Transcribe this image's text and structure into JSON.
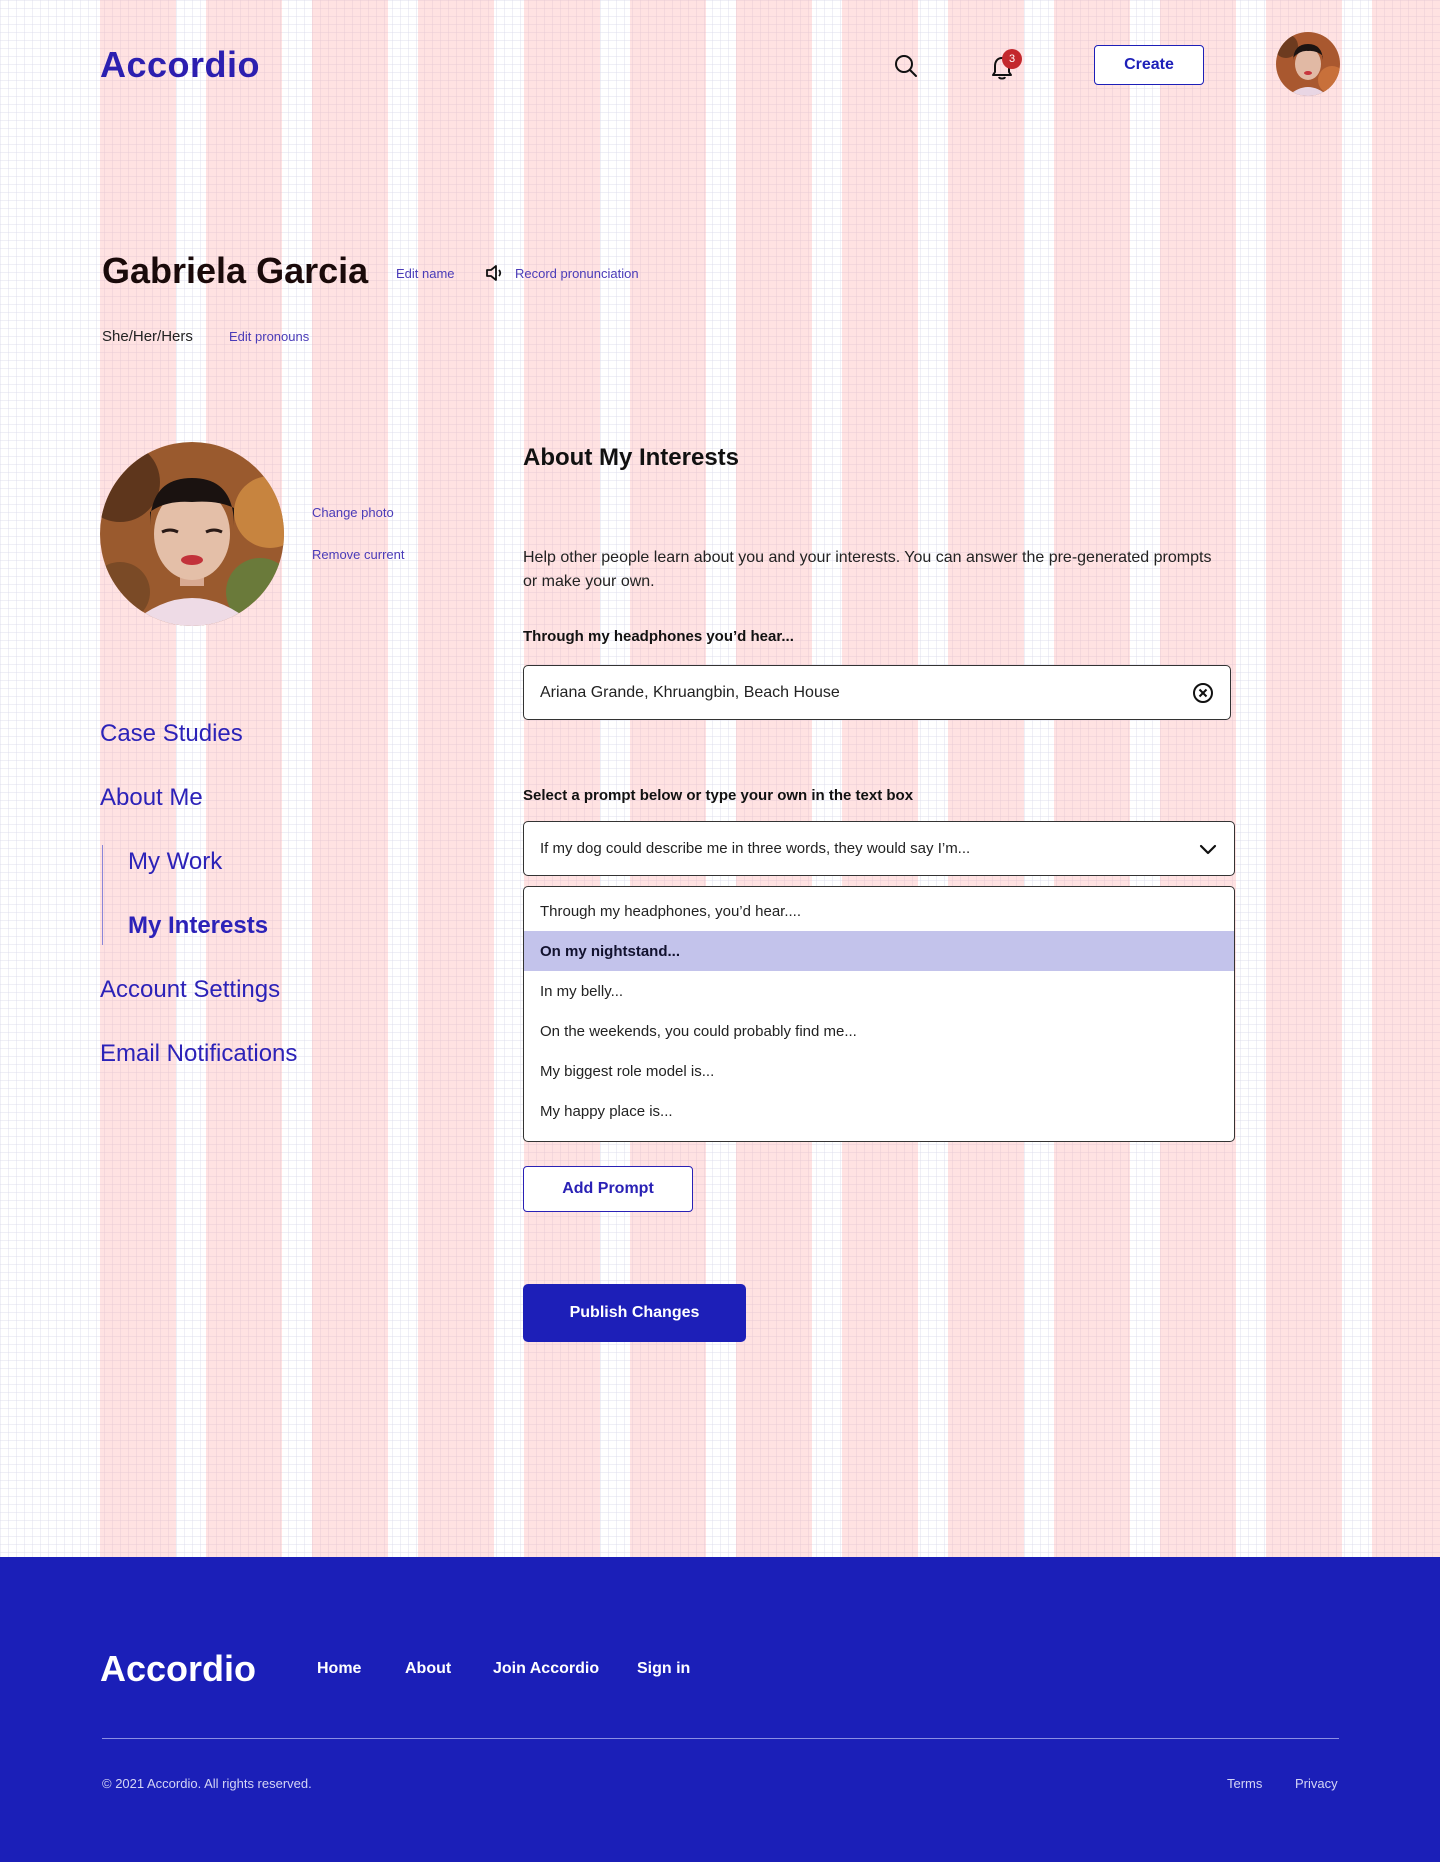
{
  "header": {
    "logo": "Accordio",
    "notification_count": "3",
    "create_label": "Create"
  },
  "profile": {
    "name": "Gabriela Garcia",
    "edit_name": "Edit name",
    "record_pronunciation": "Record pronunciation",
    "pronouns": "She/Her/Hers",
    "edit_pronouns": "Edit pronouns",
    "change_photo": "Change photo",
    "remove_current": "Remove current"
  },
  "sidebar": {
    "items": [
      {
        "label": "Case Studies"
      },
      {
        "label": "About Me"
      },
      {
        "label": "My Work"
      },
      {
        "label": "My Interests"
      },
      {
        "label": "Account Settings"
      },
      {
        "label": "Email Notifications"
      }
    ]
  },
  "main": {
    "title": "About My Interests",
    "help": "Help other people learn about you and your interests. You can answer the pre-generated prompts or make your own.",
    "field1_label": "Through my headphones you’d hear...",
    "field1_value": "Ariana Grande, Khruangbin, Beach House",
    "select_label": "Select a prompt below or type your own in the text box",
    "select_value": "If my dog could describe me in three words, they would say I’m...",
    "options": [
      "Through my headphones, you’d hear....",
      "On my nightstand...",
      "In my belly...",
      "On the weekends, you could probably find me...",
      "My biggest role model is...",
      "My happy place is..."
    ],
    "add_prompt": "Add Prompt",
    "publish": "Publish Changes"
  },
  "footer": {
    "logo": "Accordio",
    "links": [
      "Home",
      "About",
      "Join Accordio",
      "Sign in"
    ],
    "copyright": "© 2021 Accordio. All rights reserved.",
    "terms": "Terms",
    "privacy": "Privacy"
  },
  "colors": {
    "brand": "#1d1fb8",
    "highlight": "#c3c3eb",
    "badge": "#c3282d"
  }
}
